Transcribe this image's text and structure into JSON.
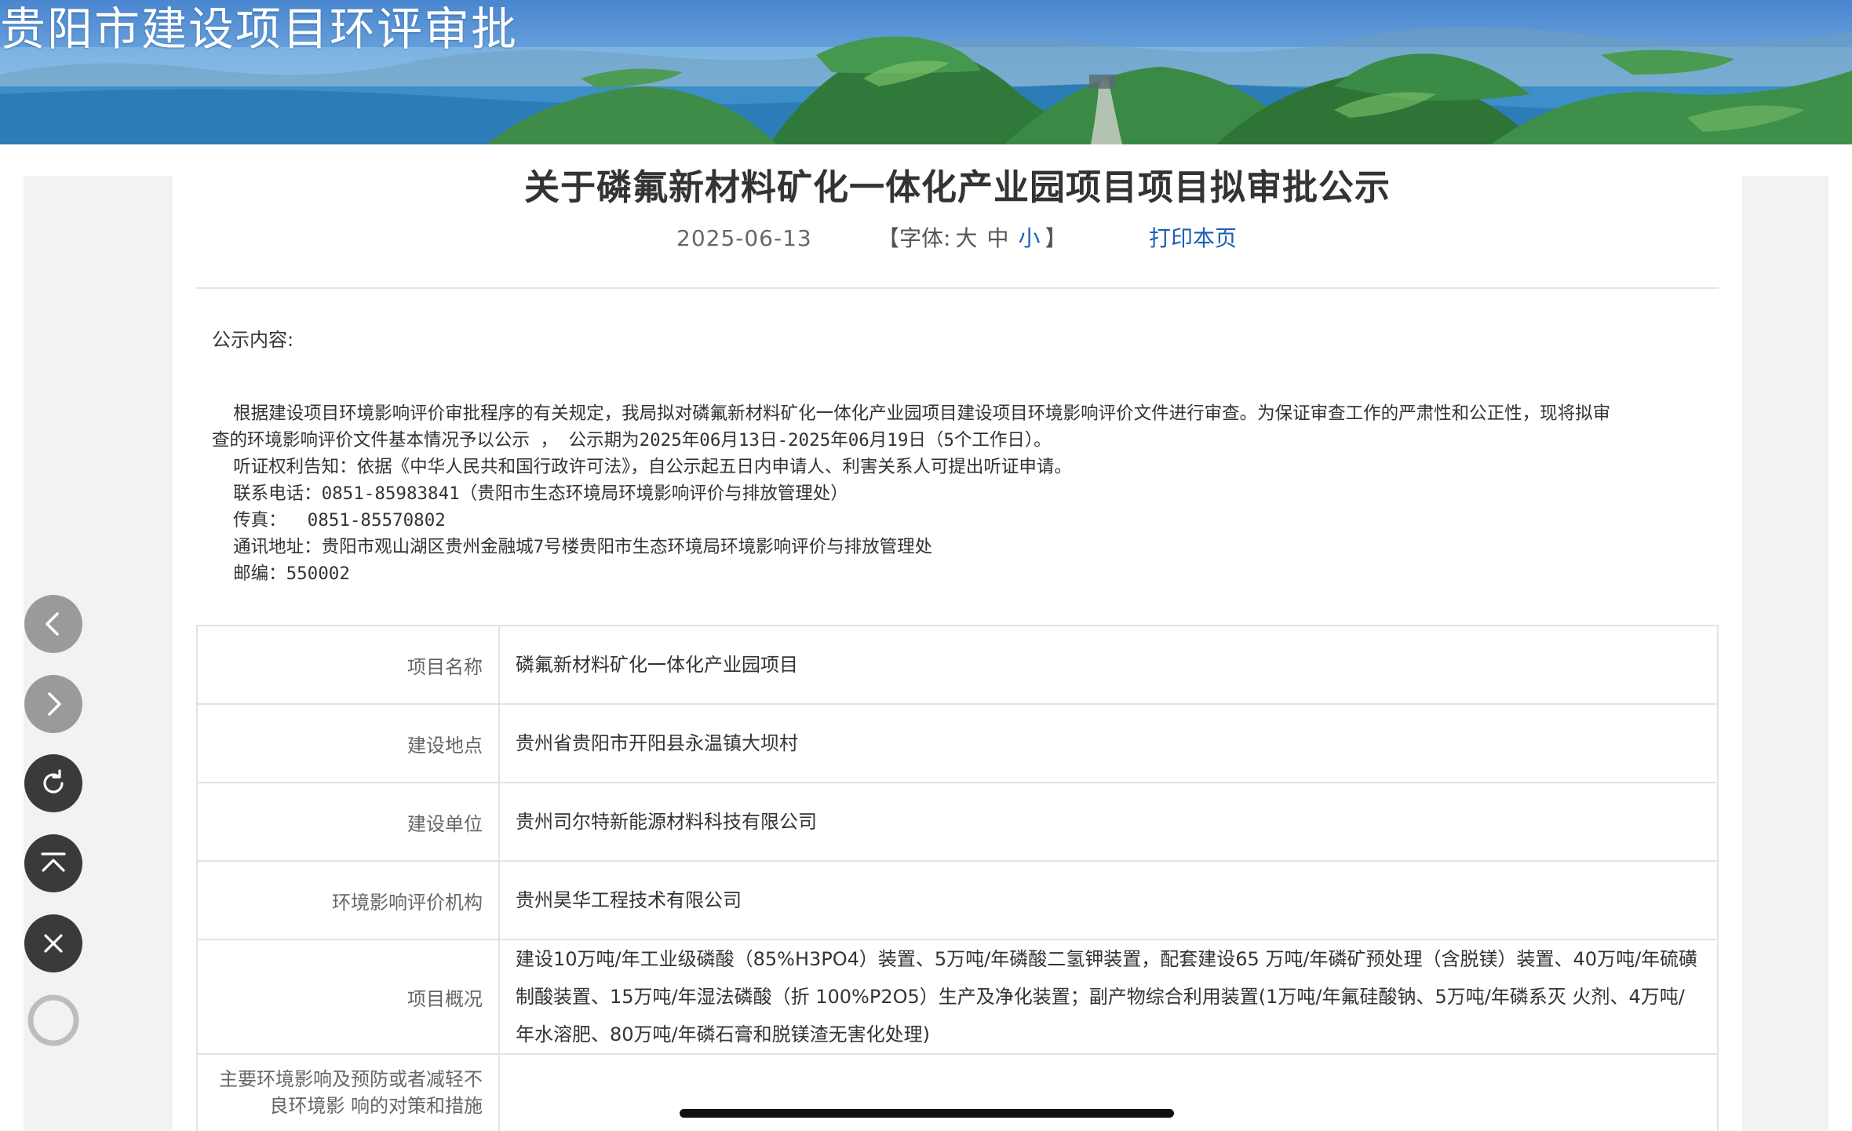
{
  "banner": {
    "site_title": "贵阳市建设项目环评审批"
  },
  "article": {
    "title": "关于磷氟新材料矿化一体化产业园项目项目拟审批公示",
    "date": "2025-06-13",
    "font_size": {
      "prefix": "【字体:",
      "large": "大",
      "medium": "中",
      "small": "小",
      "suffix": "】"
    },
    "print_label": "打印本页",
    "notice_label": "公示内容:",
    "body_lines": [
      "  根据建设项目环境影响评价审批程序的有关规定，我局拟对磷氟新材料矿化一体化产业园项目建设项目环境影响评价文件进行审查。为保证审查工作的严肃性和公正性，现将拟审",
      "查的环境影响评价文件基本情况予以公示 ， 公示期为2025年06月13日-2025年06月19日（5个工作日）。",
      "  听证权利告知：依据《中华人民共和国行政许可法》，自公示起五日内申请人、利害关系人可提出听证申请。",
      "  联系电话：0851-85983841（贵阳市生态环境局环境影响评价与排放管理处）",
      "  传真：  0851-85570802",
      "  通讯地址：贵阳市观山湖区贵州金融城7号楼贵阳市生态环境局环境影响评价与排放管理处",
      "  邮编：550002"
    ]
  },
  "info_table": {
    "rows": [
      {
        "label": "项目名称",
        "value": "磷氟新材料矿化一体化产业园项目"
      },
      {
        "label": "建设地点",
        "value": "贵州省贵阳市开阳县永温镇大坝村"
      },
      {
        "label": "建设单位",
        "value": "贵州司尔特新能源材料科技有限公司"
      },
      {
        "label": "环境影响评价机构",
        "value": "贵州昊华工程技术有限公司"
      },
      {
        "label": "项目概况",
        "value": "建设10万吨/年工业级磷酸（85%H3PO4）装置、5万吨/年磷酸二氢钾装置，配套建设65 万吨/年磷矿预处理（含脱镁）装置、40万吨/年硫磺制酸装置、15万吨/年湿法磷酸（折 100%P2O5）生产及净化装置；副产物综合利用装置(1万吨/年氟硅酸钠、5万吨/年磷系灭 火剂、4万吨/年水溶肥、80万吨/年磷石膏和脱镁渣无害化处理)"
      },
      {
        "label_line1": "主要环境影响及预防或者减轻不",
        "label_line2": "良环境影 响的对策和措施",
        "value": ""
      }
    ]
  },
  "nav_buttons": {
    "back": "chevron-left-icon",
    "forward": "chevron-right-icon",
    "reload": "reload-icon",
    "scroll_top": "scroll-top-icon",
    "close": "close-icon",
    "more": "circle-icon"
  }
}
